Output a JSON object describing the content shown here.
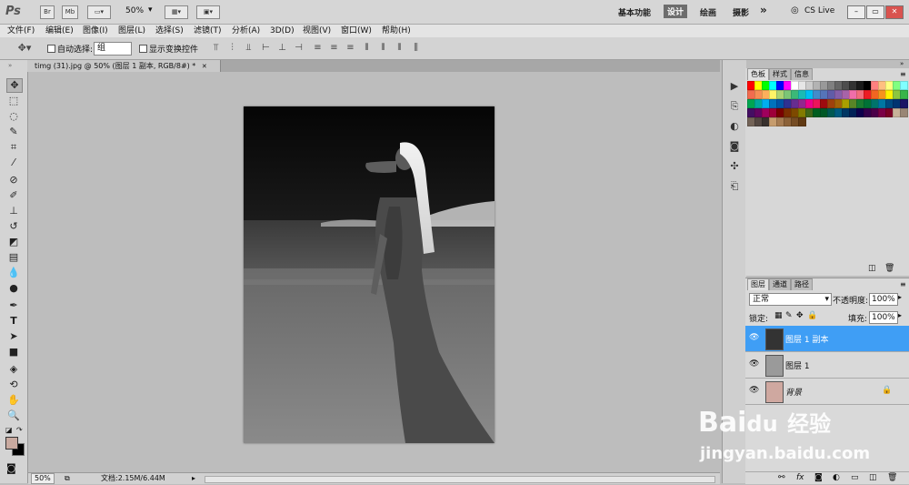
{
  "appbar": {
    "logo": "Ps",
    "br": "Br",
    "mb": "Mb",
    "zoom": "50%",
    "workspaces": [
      "基本功能",
      "设计",
      "绘画",
      "摄影"
    ],
    "more": "»",
    "cs_live": "CS Live",
    "win_min": "–",
    "win_restore": "▭",
    "win_close": "✕"
  },
  "menubar": {
    "items": [
      "文件(F)",
      "编辑(E)",
      "图像(I)",
      "图层(L)",
      "选择(S)",
      "滤镜(T)",
      "分析(A)",
      "3D(D)",
      "视图(V)",
      "窗口(W)",
      "帮助(H)"
    ]
  },
  "options": {
    "auto_select": "自动选择:",
    "auto_select_value": "组",
    "show_transform": "显示变换控件"
  },
  "document": {
    "tab_title": "timg (31).jpg @ 50% (图层 1 副本, RGB/8#) *",
    "tab_close": "✕"
  },
  "status": {
    "zoom": "50%",
    "doc_info": "文档:2.15M/6.44M"
  },
  "swatch_panel": {
    "tabs": [
      "色板",
      "样式",
      "信息"
    ]
  },
  "swatch_colors": [
    "#ff0000",
    "#ffff00",
    "#00ff00",
    "#00ffff",
    "#0000ff",
    "#ff00ff",
    "#ffffff",
    "#e6e6e6",
    "#cccccc",
    "#b3b3b3",
    "#999999",
    "#808080",
    "#666666",
    "#4d4d4d",
    "#333333",
    "#1a1a1a",
    "#000000",
    "#ff8080",
    "#ffbf80",
    "#ffff80",
    "#80ff80",
    "#80ffff",
    "#f26c4f",
    "#f68e55",
    "#fbaf5c",
    "#fff467",
    "#acd372",
    "#7cc576",
    "#3bb878",
    "#1abbb4",
    "#00bff3",
    "#438ccb",
    "#5574b9",
    "#605ca8",
    "#855fa8",
    "#a763a8",
    "#f06ea9",
    "#f26d7d",
    "#ed1c24",
    "#f26522",
    "#f7941d",
    "#fff200",
    "#8dc63f",
    "#39b54a",
    "#00a651",
    "#00a99d",
    "#00aeef",
    "#0072bc",
    "#0054a6",
    "#2e3192",
    "#662d91",
    "#92278f",
    "#ec008c",
    "#ed145b",
    "#9e0b0f",
    "#a0410d",
    "#a3620a",
    "#aba000",
    "#598527",
    "#197b30",
    "#007236",
    "#00746b",
    "#0076a3",
    "#004a80",
    "#003471",
    "#1b1464",
    "#440e62",
    "#630460",
    "#9e005d",
    "#9e0039",
    "#790000",
    "#7b2e00",
    "#7d4900",
    "#827b00",
    "#406618",
    "#005e20",
    "#005826",
    "#005952",
    "#005b7f",
    "#003663",
    "#002157",
    "#0d004c",
    "#32004b",
    "#4b0049",
    "#7b0046",
    "#7a0026",
    "#c7b299",
    "#998675",
    "#736357",
    "#534741",
    "#37302d",
    "#c69c6d",
    "#a67c52",
    "#8c6239",
    "#754c24",
    "#603913"
  ],
  "layers": {
    "tabs": [
      "图层",
      "通道",
      "路径"
    ],
    "blend_mode": "正常",
    "opacity_label": "不透明度:",
    "opacity_value": "100%",
    "lock_label": "锁定:",
    "fill_label": "填充:",
    "fill_value": "100%",
    "items": [
      {
        "name": "图层 1 副本",
        "selected": true
      },
      {
        "name": "图层 1",
        "selected": false
      },
      {
        "name": "背景",
        "selected": false
      }
    ]
  },
  "watermark": {
    "brand": "Bai",
    "paw": "du",
    "cn": "经验",
    "url": "jingyan.baidu.com"
  }
}
